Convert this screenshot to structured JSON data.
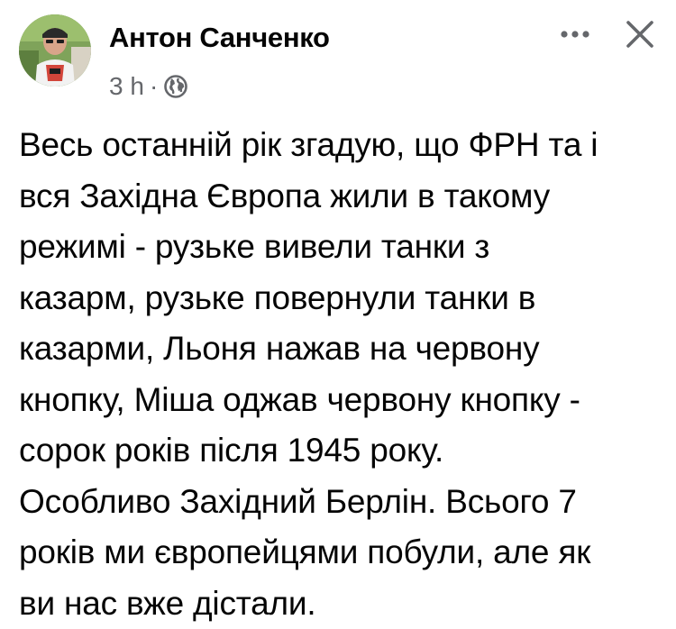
{
  "post": {
    "author": "Антон Санченко",
    "timestamp": "3 h",
    "separator": "·",
    "audience_icon": "globe-icon",
    "more_icon": "more-horizontal-icon",
    "close_icon": "close-icon",
    "text_lines": [
      "Весь останній рік згадую, що ФРН та і",
      "вся Західна Європа жили в такому",
      "режимі - рузьке вивели танки з",
      "казарм, рузьке повернули танки в",
      "казарми, Льоня нажав на червону",
      "кнопку, Міша оджав червону кнопку -",
      "сорок років після 1945 року.",
      "Особливо Західний Берлін. Всього 7",
      "років ми європейцями побули, але як",
      "ви нас вже дістали."
    ]
  },
  "colors": {
    "text": "#050505",
    "secondary_text": "#65676b",
    "icon": "#65676b"
  }
}
